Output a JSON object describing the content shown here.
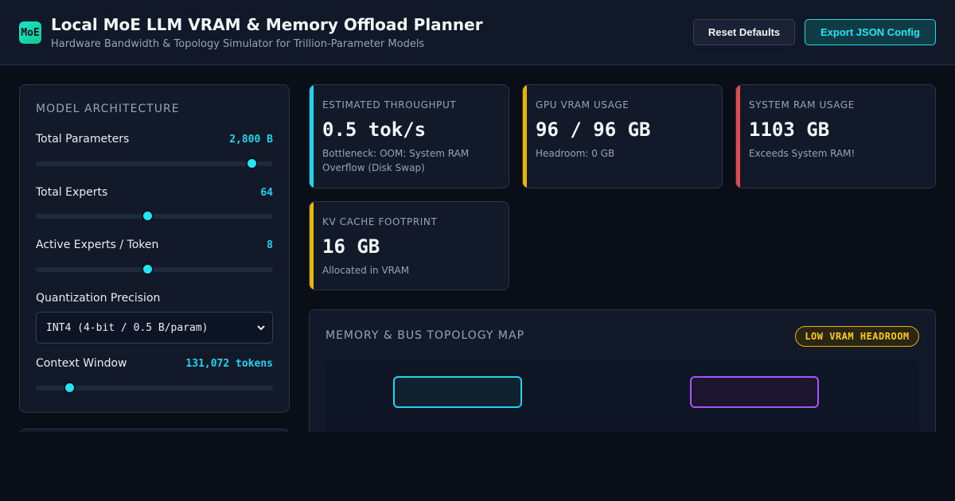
{
  "header": {
    "logo_text": "MoE",
    "title": "Local MoE LLM VRAM & Memory Offload Planner",
    "subtitle": "Hardware Bandwidth & Topology Simulator for Trillion-Parameter Models",
    "reset_label": "Reset Defaults",
    "export_label": "Export JSON Config"
  },
  "model_panel": {
    "title": "MODEL ARCHITECTURE",
    "total_params": {
      "label": "Total Parameters",
      "value": "2,800 B",
      "level": 0.91
    },
    "total_experts": {
      "label": "Total Experts",
      "value": "64",
      "level": 0.47
    },
    "active_experts": {
      "label": "Active Experts / Token",
      "value": "8",
      "level": 0.47
    },
    "quantization": {
      "label": "Quantization Precision",
      "selected": "INT4 (4-bit / 0.5 B/param)"
    },
    "context": {
      "label": "Context Window",
      "value": "131,072 tokens",
      "level": 0.14
    }
  },
  "metrics": {
    "throughput": {
      "label": "ESTIMATED THROUGHPUT",
      "value": "0.5 tok/s",
      "sub": "Bottleneck: OOM: System RAM Overflow (Disk Swap)",
      "accent": "#22d3ee"
    },
    "vram": {
      "label": "GPU VRAM USAGE",
      "value": "96 / 96 GB",
      "sub": "Headroom: 0 GB",
      "accent": "#eab308"
    },
    "ram": {
      "label": "SYSTEM RAM USAGE",
      "value": "1103 GB",
      "sub": "Exceeds System RAM!",
      "accent": "#e5484d"
    },
    "kv": {
      "label": "KV CACHE FOOTPRINT",
      "value": "16 GB",
      "sub": "Allocated in VRAM",
      "accent": "#eab308"
    }
  },
  "topology": {
    "title": "MEMORY & BUS TOPOLOGY MAP",
    "badge": "LOW VRAM HEADROOM"
  }
}
